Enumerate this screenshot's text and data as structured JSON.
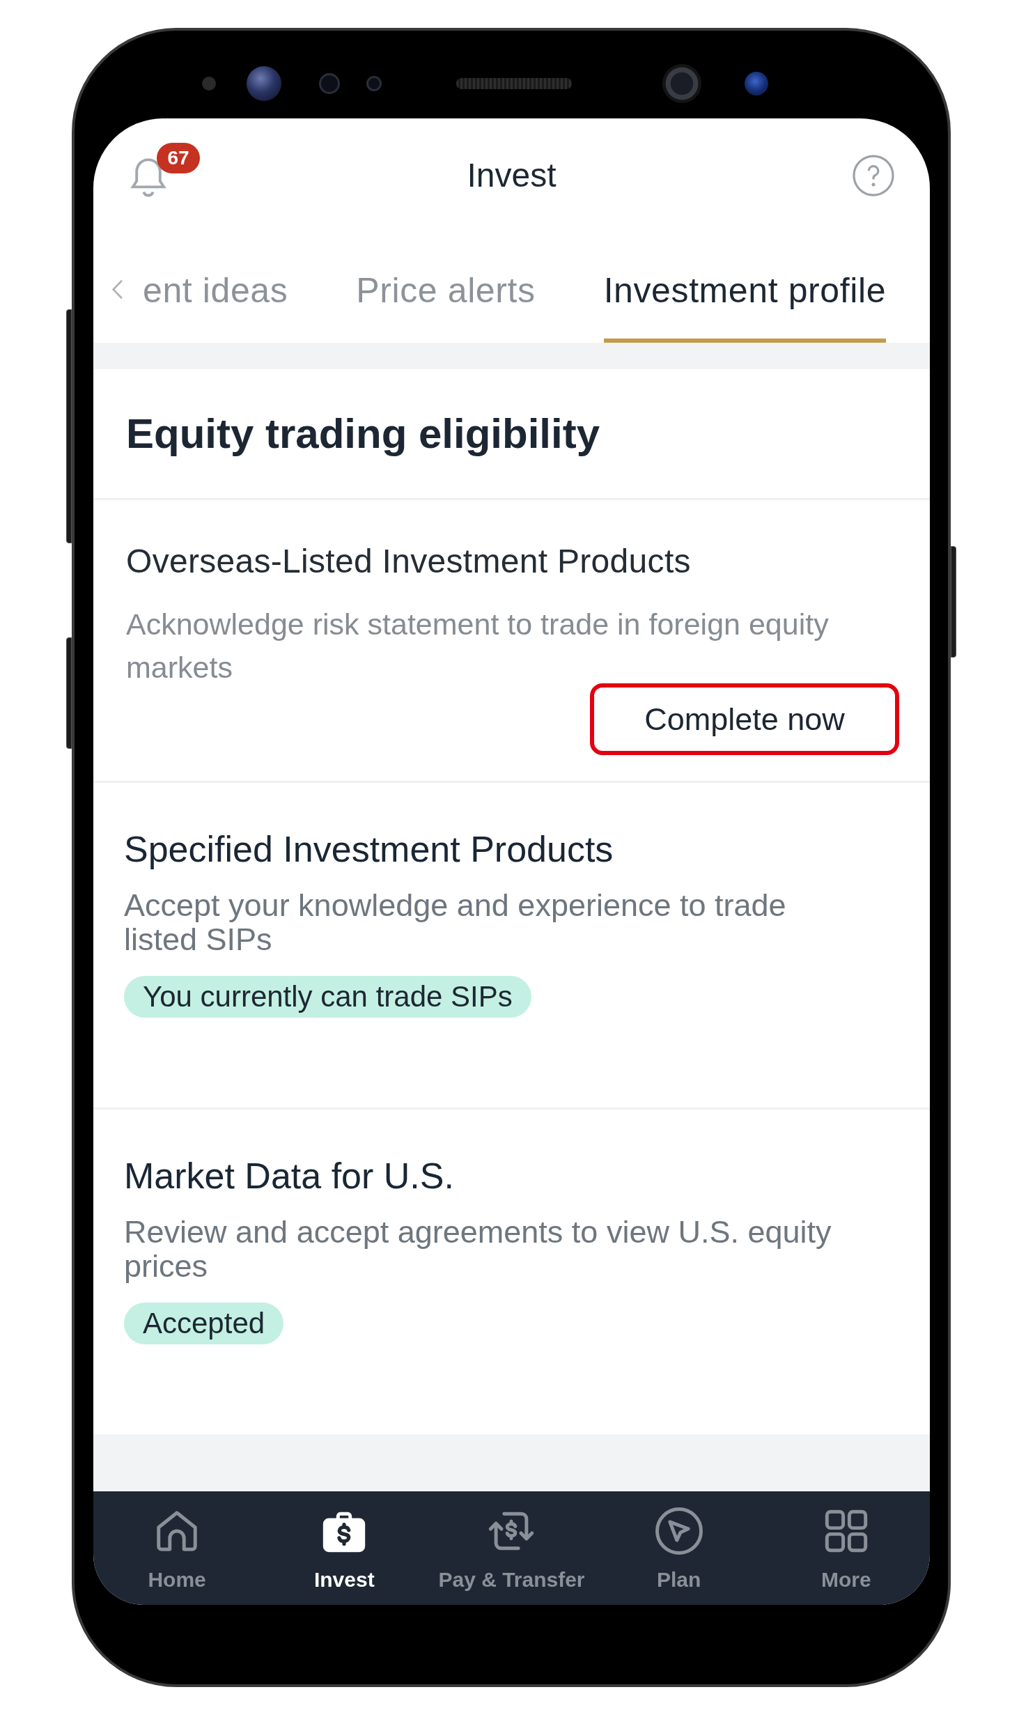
{
  "header": {
    "title": "Invest",
    "notification_count": "67"
  },
  "tabs": [
    {
      "label": "ent ideas",
      "selected": false
    },
    {
      "label": "Price alerts",
      "selected": false
    },
    {
      "label": "Investment profile",
      "selected": true
    }
  ],
  "eligibility": {
    "title": "Equity trading eligibility",
    "items": [
      {
        "kind": "action",
        "title": "Overseas-Listed Investment Products",
        "description": "Acknowledge risk statement to trade in foreign equity markets",
        "button": {
          "label": "Complete now",
          "highlighted": true
        }
      },
      {
        "kind": "status",
        "title": "Specified Investment Products",
        "description": "Accept your knowledge and experience to trade listed SIPs",
        "status": "You currently can trade SIPs"
      },
      {
        "kind": "status",
        "title": "Market Data for U.S.",
        "description": "Review and accept agreements to view U.S. equity prices",
        "status": "Accepted"
      }
    ]
  },
  "bottom_nav": [
    {
      "label": "Home",
      "selected": false
    },
    {
      "label": "Invest",
      "selected": true
    },
    {
      "label": "Pay & Transfer",
      "selected": false
    },
    {
      "label": "Plan",
      "selected": false
    },
    {
      "label": "More",
      "selected": false
    }
  ]
}
